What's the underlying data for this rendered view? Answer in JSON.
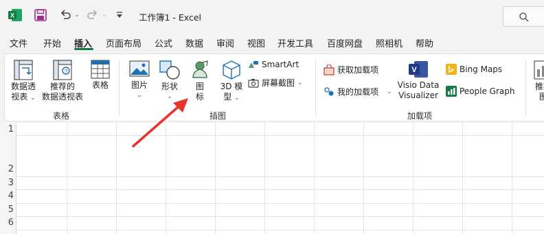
{
  "window": {
    "title": "工作簿1  -  Excel"
  },
  "menu": {
    "tabs": [
      "文件",
      "开始",
      "插入",
      "页面布局",
      "公式",
      "数据",
      "审阅",
      "视图",
      "开发工具",
      "百度网盘",
      "照相机",
      "帮助"
    ],
    "active": "插入"
  },
  "ribbon": {
    "tables": {
      "group_label": "表格",
      "pivot_table": [
        "数据透",
        "视表"
      ],
      "recommended_pivot": [
        "推荐的",
        "数据透视表"
      ],
      "table": "表格"
    },
    "illustrations": {
      "group_label": "插图",
      "pictures": "图片",
      "shapes": "形状",
      "icons": [
        "图",
        "标"
      ],
      "models3d": [
        "3D 模",
        "型"
      ],
      "smartart": "SmartArt",
      "screenshot": "屏幕截图"
    },
    "addins": {
      "group_label": "加载项",
      "get_addins": "获取加载项",
      "my_addins": "我的加载项",
      "visio": [
        "Visio Data",
        "Visualizer"
      ],
      "bing_maps": "Bing Maps",
      "people_graph": "People Graph"
    },
    "recommended_charts": [
      "推荐",
      "图"
    ]
  },
  "sheet": {
    "row_numbers": [
      "1",
      "2",
      "3",
      "4",
      "5",
      "6"
    ]
  },
  "colors": {
    "accent": "#107c41",
    "arrow": "#e8322b"
  }
}
